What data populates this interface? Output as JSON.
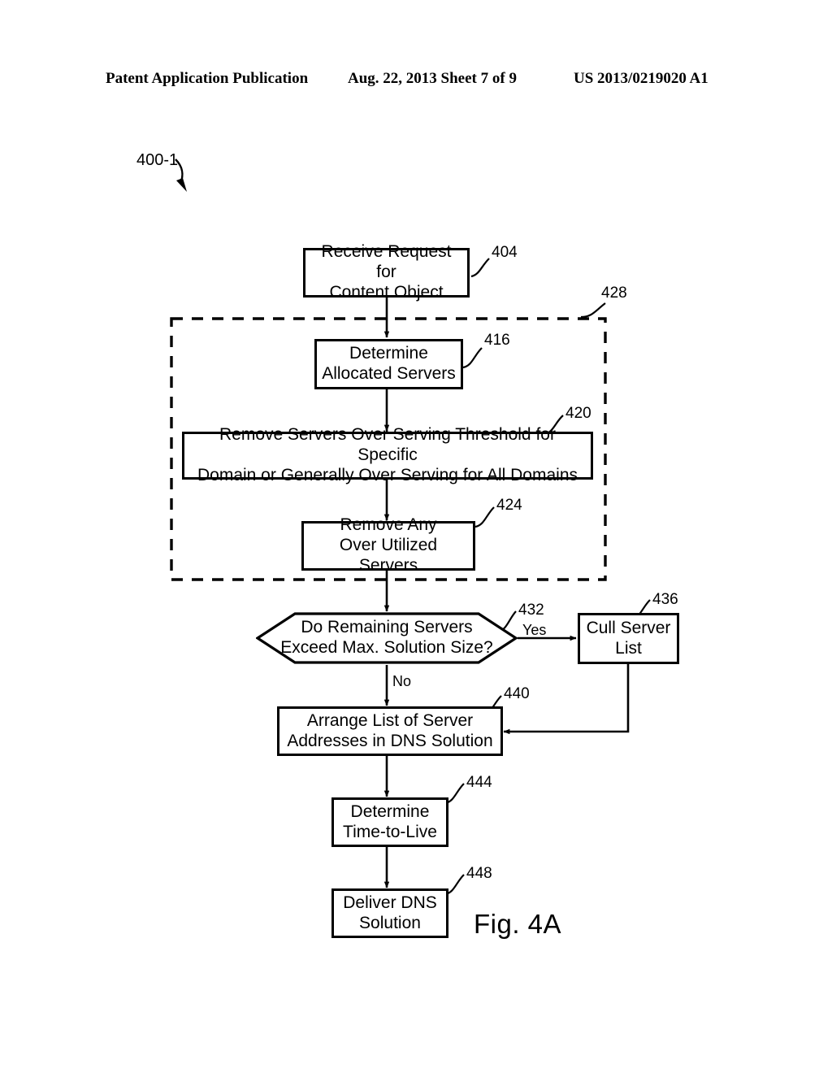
{
  "header": {
    "left": "Patent Application Publication",
    "center": "Aug. 22, 2013  Sheet 7 of 9",
    "right": "US 2013/0219020 A1"
  },
  "figure": {
    "caption": "Fig. 4A",
    "diagram_tag": "400-1",
    "group_ref": "428",
    "type": "flowchart",
    "nodes": [
      {
        "ref": "404",
        "label": "Receive Request for\nContent Object",
        "shape": "rect"
      },
      {
        "ref": "416",
        "label": "Determine\nAllocated Servers",
        "shape": "rect"
      },
      {
        "ref": "420",
        "label": "Remove Servers Over Serving Threshold for Specific\nDomain or Generally Over Serving for All Domains",
        "shape": "rect"
      },
      {
        "ref": "424",
        "label": "Remove Any\nOver Utilized Servers",
        "shape": "rect"
      },
      {
        "ref": "432",
        "label": "Do Remaining Servers\nExceed Max. Solution Size?",
        "shape": "hexagon"
      },
      {
        "ref": "436",
        "label": "Cull Server\nList",
        "shape": "rect"
      },
      {
        "ref": "440",
        "label": "Arrange List of Server\nAddresses in DNS Solution",
        "shape": "rect"
      },
      {
        "ref": "444",
        "label": "Determine\nTime-to-Live",
        "shape": "rect"
      },
      {
        "ref": "448",
        "label": "Deliver DNS\nSolution",
        "shape": "rect"
      }
    ],
    "branches": {
      "yes": "Yes",
      "no": "No"
    },
    "colors": {
      "ink": "#000000",
      "paper": "#ffffff"
    }
  }
}
